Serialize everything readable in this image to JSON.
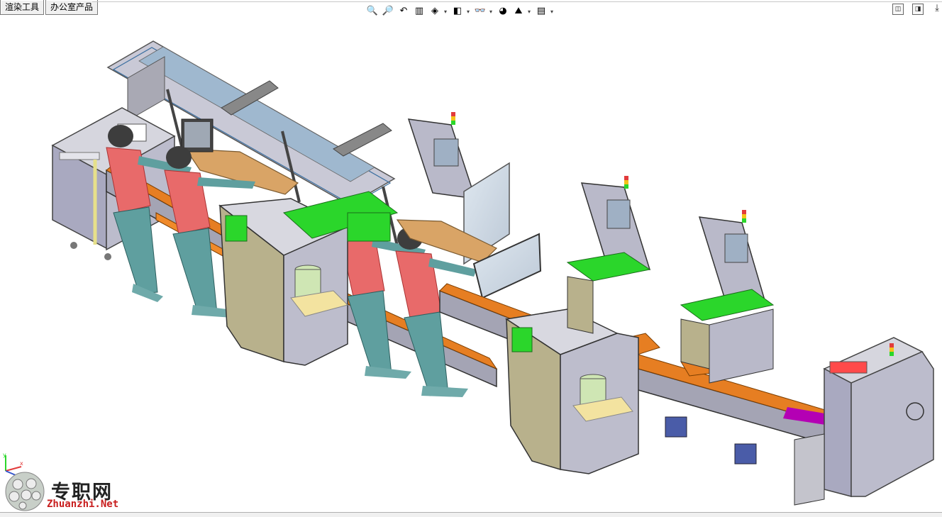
{
  "tabs": [
    {
      "label": "渲染工具"
    },
    {
      "label": "办公室产品"
    }
  ],
  "toolbar": [
    {
      "icon": "zoom-to-fit-icon",
      "glyph": "🔍",
      "dropdown": false
    },
    {
      "icon": "zoom-to-area-icon",
      "glyph": "🔎",
      "dropdown": false
    },
    {
      "icon": "previous-view-icon",
      "glyph": "↶",
      "dropdown": false
    },
    {
      "icon": "section-view-icon",
      "glyph": "▥",
      "dropdown": false
    },
    {
      "icon": "view-orientation-icon",
      "glyph": "◈",
      "dropdown": true
    },
    {
      "icon": "display-style-icon",
      "glyph": "◧",
      "dropdown": true
    },
    {
      "icon": "hide-show-items-icon",
      "glyph": "👓",
      "dropdown": true
    },
    {
      "icon": "edit-appearance-icon",
      "glyph": "◕",
      "dropdown": false
    },
    {
      "icon": "apply-scene-icon",
      "glyph": "⛰",
      "dropdown": true
    },
    {
      "icon": "view-settings-icon",
      "glyph": "▤",
      "dropdown": true
    }
  ],
  "window_controls": [
    {
      "icon": "restore-icon",
      "glyph": "◫"
    },
    {
      "icon": "tile-icon",
      "glyph": "◨"
    },
    {
      "icon": "minimize-icon",
      "glyph": "⤓"
    }
  ],
  "watermark": {
    "name": "专职网",
    "url": "Zhuanzhi.Net"
  },
  "colors": {
    "frame_grey": "#b9b9c9",
    "frame_dark": "#5a5a5a",
    "panel_olive": "#b8b18c",
    "machine_green": "#2bd62b",
    "plate_orange": "#e67e22",
    "magenta_parts": "#b400b4",
    "operator_red": "#e86a6a",
    "operator_teal": "#5f9f9f",
    "wood_table": "#d9a466",
    "motor_blue": "#4a5ca8",
    "barrel_green": "#cfe6b4",
    "watermark_red": "#c81e1e"
  }
}
